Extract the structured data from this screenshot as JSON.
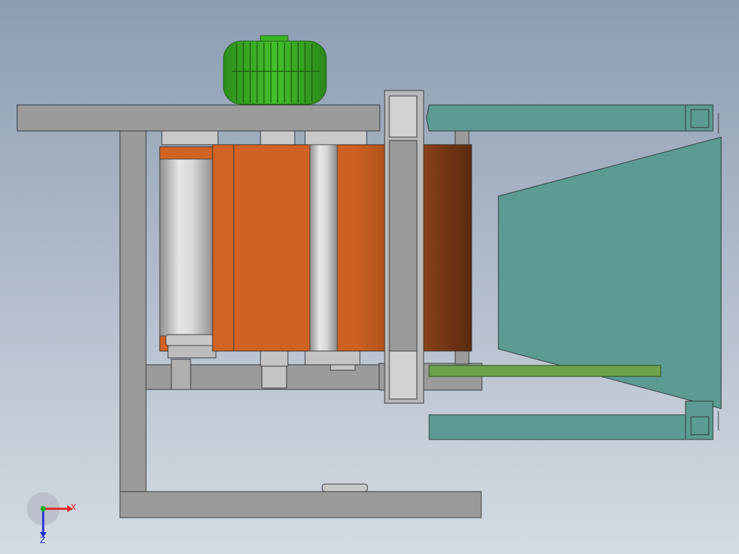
{
  "view": {
    "background_top": "#8c9db2",
    "background_bottom": "#d5dbe3"
  },
  "colors": {
    "frame_gray": "#9b9b9b",
    "roller_orange": "#d06325",
    "roller_orange_dark": "#5a2a10",
    "hopper_teal": "#5b9b94",
    "motor_green": "#3cb526",
    "shaft_silver": "#d8d8d8",
    "plate_green": "#6fa24d"
  },
  "parts": [
    "motor-icon",
    "frame",
    "roller-assembly",
    "bearing-block",
    "hopper",
    "discharge-plate"
  ],
  "triad": {
    "x_label": "X",
    "z_label": "Z",
    "x_color": "#e02020",
    "z_color": "#2030d0",
    "y_color": "#20b020"
  }
}
